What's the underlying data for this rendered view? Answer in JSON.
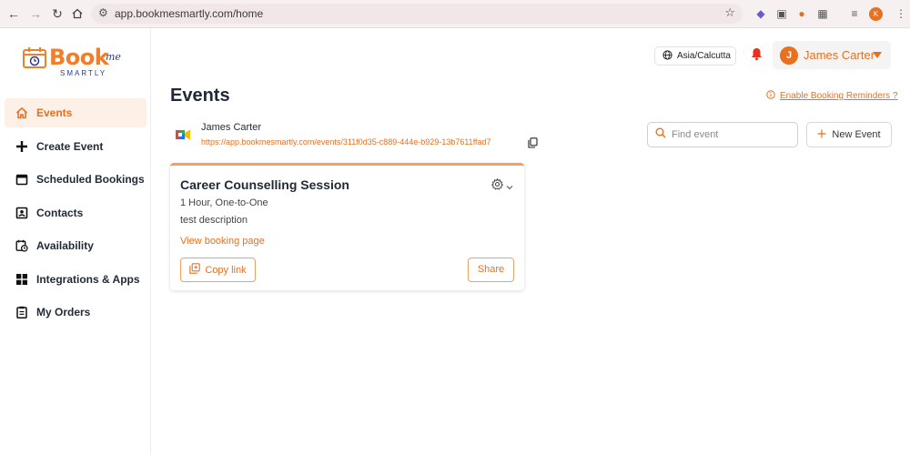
{
  "browser": {
    "url": "app.bookmesmartly.com/home",
    "profile_initial": "K",
    "icons": [
      "back-icon",
      "forward-icon",
      "reload-icon",
      "home-icon",
      "site-settings-icon",
      "bookmark-star-icon"
    ]
  },
  "brand": {
    "word": "Book",
    "suffix": "me",
    "tagline": "SMARTLY",
    "accent_color": "#e8701f",
    "secondary_color": "#2a3b8f"
  },
  "sidebar": {
    "items": [
      {
        "label": "Events",
        "icon": "home-icon",
        "active": true
      },
      {
        "label": "Create Event",
        "icon": "plus-icon",
        "active": false
      },
      {
        "label": "Scheduled Bookings",
        "icon": "calendar-icon",
        "active": false
      },
      {
        "label": "Contacts",
        "icon": "contact-card-icon",
        "active": false
      },
      {
        "label": "Availability",
        "icon": "calendar-clock-icon",
        "active": false
      },
      {
        "label": "Integrations & Apps",
        "icon": "grid-icon",
        "active": false
      },
      {
        "label": "My Orders",
        "icon": "clipboard-icon",
        "active": false
      }
    ]
  },
  "header": {
    "timezone": "Asia/Calcutta",
    "user_initial": "J",
    "user_name": "James Carter"
  },
  "main": {
    "title": "Events",
    "reminder_link": "Enable Booking Reminders ?",
    "owner_name": "James Carter",
    "owner_url": "https://app.bookmesmartly.com/events/311f0d35-c889-444e-b929-13b7611ffad7",
    "search_placeholder": "Find event",
    "new_event_label": "New Event"
  },
  "event_card": {
    "title": "Career Counselling Session",
    "meta": "1 Hour, One-to-One",
    "description": "test description",
    "view_link": "View booking page",
    "copy_label": "Copy link",
    "share_label": "Share"
  }
}
